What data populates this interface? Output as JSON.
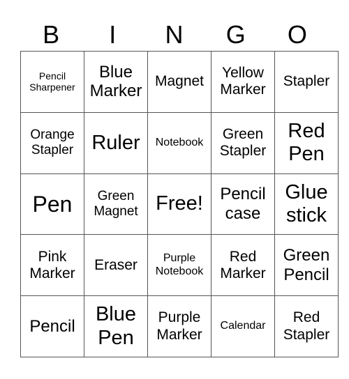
{
  "header": [
    "B",
    "I",
    "N",
    "G",
    "O"
  ],
  "rows": [
    [
      {
        "text": "Pencil Sharpener",
        "size": "s14"
      },
      {
        "text": "Blue Marker",
        "size": "s24"
      },
      {
        "text": "Magnet",
        "size": "s21"
      },
      {
        "text": "Yellow Marker",
        "size": "s21"
      },
      {
        "text": "Stapler",
        "size": "s21"
      }
    ],
    [
      {
        "text": "Orange Stapler",
        "size": "s19"
      },
      {
        "text": "Ruler",
        "size": "s29"
      },
      {
        "text": "Notebook",
        "size": "s16"
      },
      {
        "text": "Green Stapler",
        "size": "s21"
      },
      {
        "text": "Red Pen",
        "size": "s29"
      }
    ],
    [
      {
        "text": "Pen",
        "size": "s32"
      },
      {
        "text": "Green Magnet",
        "size": "s19"
      },
      {
        "text": "Free!",
        "size": "s29"
      },
      {
        "text": "Pencil case",
        "size": "s24"
      },
      {
        "text": "Glue stick",
        "size": "s29"
      }
    ],
    [
      {
        "text": "Pink Marker",
        "size": "s21"
      },
      {
        "text": "Eraser",
        "size": "s21"
      },
      {
        "text": "Purple Notebook",
        "size": "s16"
      },
      {
        "text": "Red Marker",
        "size": "s21"
      },
      {
        "text": "Green Pencil",
        "size": "s24"
      }
    ],
    [
      {
        "text": "Pencil",
        "size": "s24"
      },
      {
        "text": "Blue Pen",
        "size": "s29"
      },
      {
        "text": "Purple Marker",
        "size": "s21"
      },
      {
        "text": "Calendar",
        "size": "s16"
      },
      {
        "text": "Red Stapler",
        "size": "s21"
      }
    ]
  ]
}
